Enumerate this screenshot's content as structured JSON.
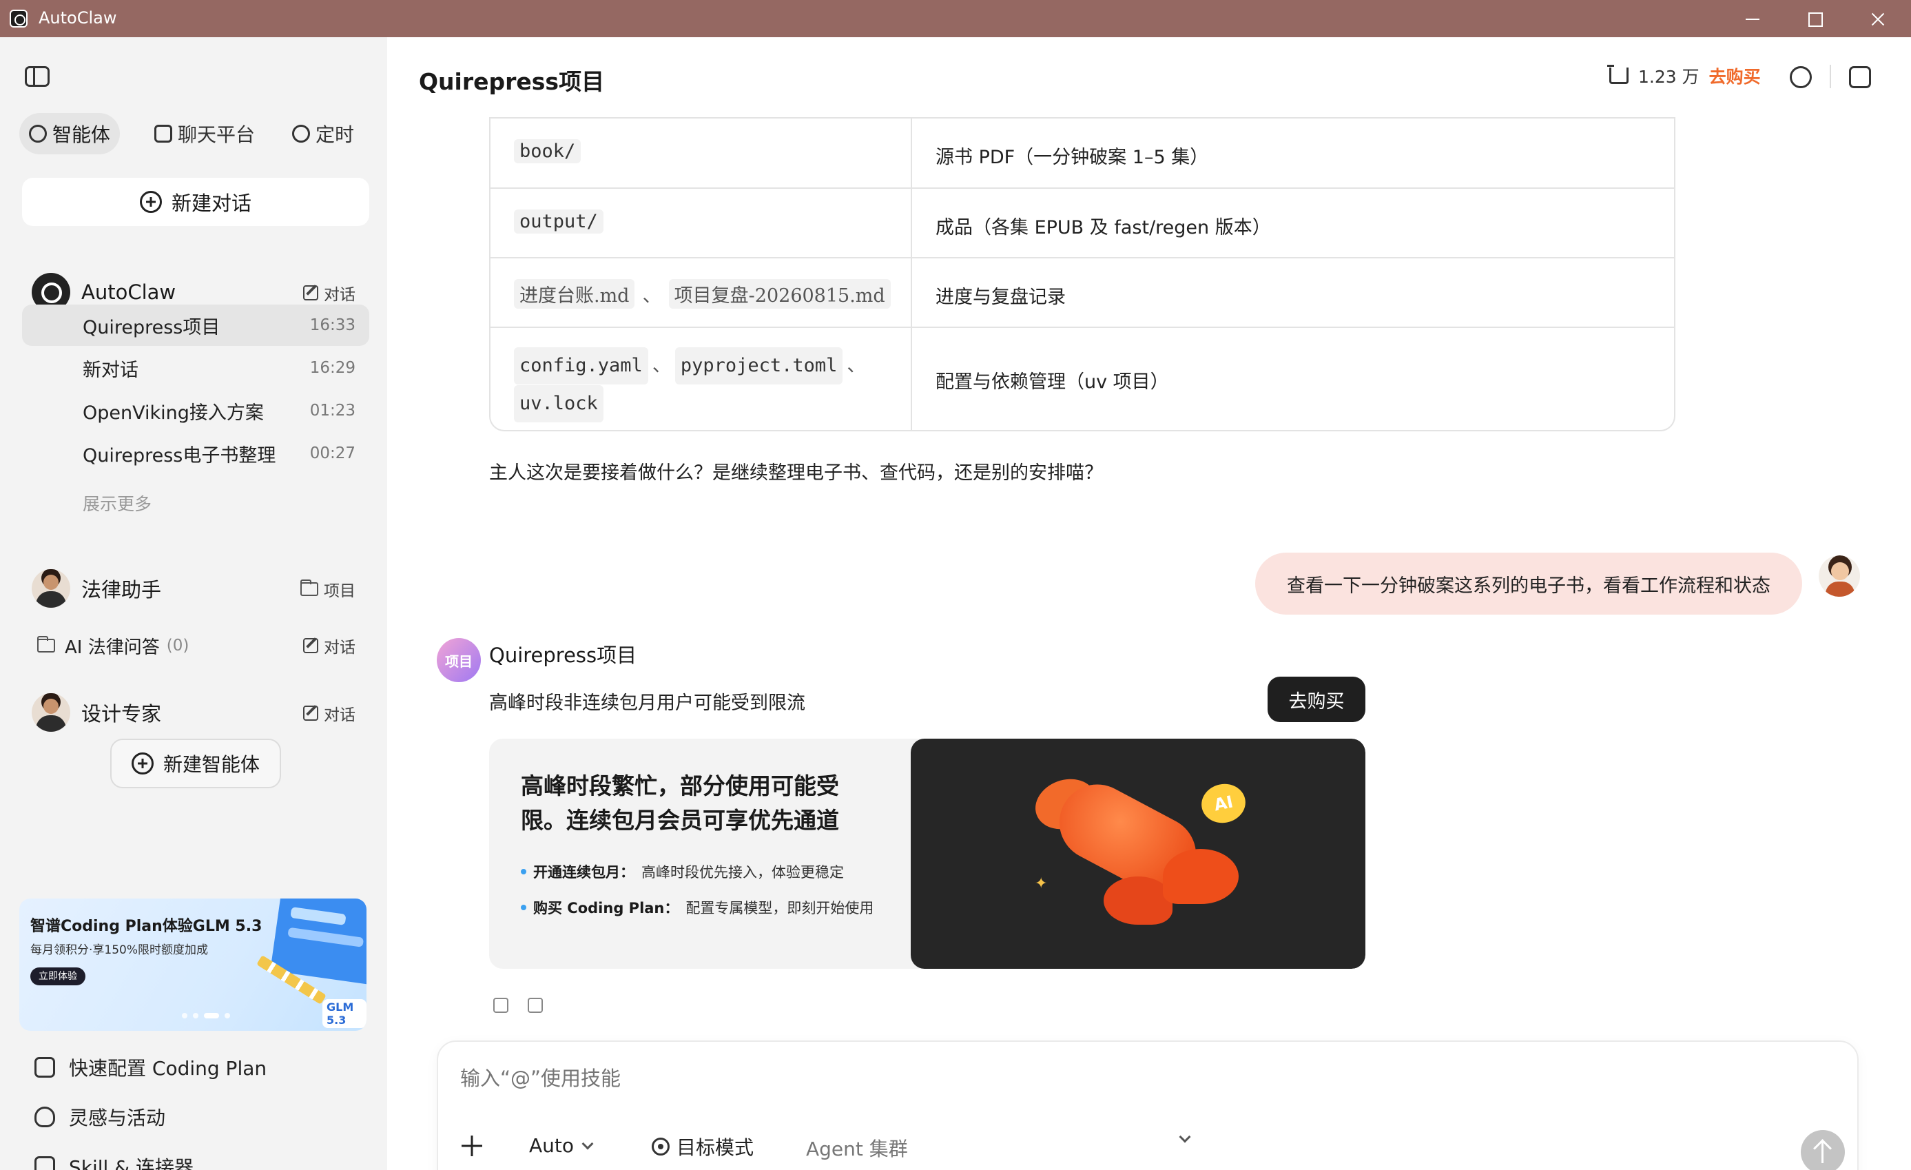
{
  "window": {
    "title": "AutoClaw"
  },
  "sidebar": {
    "tabs": [
      {
        "label": "智能体",
        "icon": "agent-icon",
        "active": true
      },
      {
        "label": "聊天平台",
        "icon": "chat-platform-icon",
        "active": false
      },
      {
        "label": "定时",
        "icon": "clock-icon",
        "active": false
      }
    ],
    "new_chat_label": "新建对话",
    "autoclaw": {
      "name": "AutoClaw",
      "action_label": "对话",
      "conversations": [
        {
          "title": "Quirepress项目",
          "time": "16:33",
          "active": true
        },
        {
          "title": "新对话",
          "time": "16:29",
          "active": false
        },
        {
          "title": "OpenViking接入方案",
          "time": "01:23",
          "active": false
        },
        {
          "title": "Quirepress电子书整理",
          "time": "00:27",
          "active": false
        }
      ],
      "show_more": "展示更多"
    },
    "legal": {
      "name": "法律助手",
      "action_label": "项目",
      "sub": {
        "label": "AI 法律问答",
        "count": "(0)",
        "action_label": "对话"
      }
    },
    "design": {
      "name": "设计专家",
      "action_label": "对话"
    },
    "new_agent_label": "新建智能体",
    "promo": {
      "title": "智谱Coding Plan体验GLM 5.3",
      "subtitle": "每月领积分·享150%限时额度加成",
      "button": "立即体验",
      "badge": "GLM 5.3"
    },
    "bottom_nav": [
      {
        "label": "快速配置 Coding Plan",
        "icon": "key-icon"
      },
      {
        "label": "灵感与活动",
        "icon": "lightbulb-icon"
      },
      {
        "label": "Skill & 连接器",
        "icon": "skill-icon"
      }
    ]
  },
  "header": {
    "title": "Quirepress项目",
    "credits": "1.23 万",
    "buy_label": "去购买"
  },
  "file_table": {
    "rows": [
      {
        "paths": [
          "book/"
        ],
        "desc": "源书 PDF（一分钟破案 1–5 集）"
      },
      {
        "paths": [
          "output/"
        ],
        "desc": "成品（各集 EPUB 及 fast/regen 版本）"
      },
      {
        "paths": [
          "进度台账.md",
          "项目复盘-20260815.md"
        ],
        "desc": "进度与复盘记录"
      },
      {
        "paths": [
          "config.yaml",
          "pyproject.toml",
          "uv.lock"
        ],
        "desc": "配置与依赖管理（uv 项目）"
      }
    ],
    "separator": "、"
  },
  "assistant_reply": "主人这次是要接着做什么？是继续整理电子书、查代码，还是别的安排喵？",
  "user_message": "查看一下一分钟破案这系列的电子书，看看工作流程和状态",
  "bot": {
    "avatar_text": "项目",
    "name": "Quirepress项目",
    "notice": "高峰时段非连续包月用户可能受到限流",
    "buy_button": "去购买",
    "card": {
      "headline": "高峰时段繁忙，部分使用可能受限。连续包月会员可享优先通道",
      "items": [
        {
          "title": "开通连续包月：",
          "desc": "高峰时段优先接入，体验更稳定"
        },
        {
          "title": "购买 Coding Plan：",
          "desc": "配置专属模型，即刻开始使用"
        }
      ],
      "image_badge": "AI"
    }
  },
  "composer": {
    "placeholder": "输入“@”使用技能",
    "mode": "Auto",
    "goal_label": "目标模式",
    "agent_cluster": "Agent 集群"
  }
}
